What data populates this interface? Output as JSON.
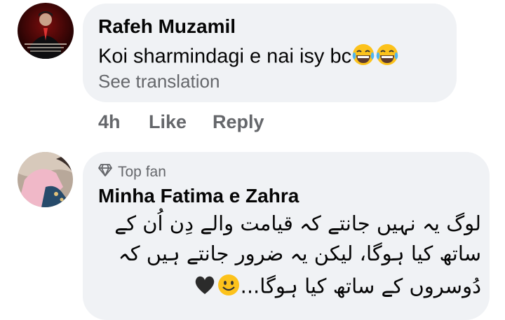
{
  "comment1": {
    "author": "Rafeh Muzamil",
    "text": "Koi sharmindagi e nai isy bc",
    "emojis": [
      "face-with-tears-of-joy",
      "face-with-tears-of-joy"
    ],
    "see_translation": "See translation",
    "time": "4h",
    "like": "Like",
    "reply": "Reply"
  },
  "comment2": {
    "badge": "Top fan",
    "author": "Minha Fatima e Zahra",
    "lines": [
      "لوگ یہ نہیں جانتے کہ قیامت والے دِن اُن کے",
      "ساتھ کیا ہوگا، لیکن یہ ضرور جانتے ہیں کہ",
      "دُوسروں کے ساتھ کیا ہوگا..."
    ],
    "emojis": [
      "smiling-face",
      "black-heart"
    ]
  },
  "colors": {
    "bubble": "#f0f2f5",
    "secondary_text": "#65676b",
    "primary_text": "#050505"
  }
}
